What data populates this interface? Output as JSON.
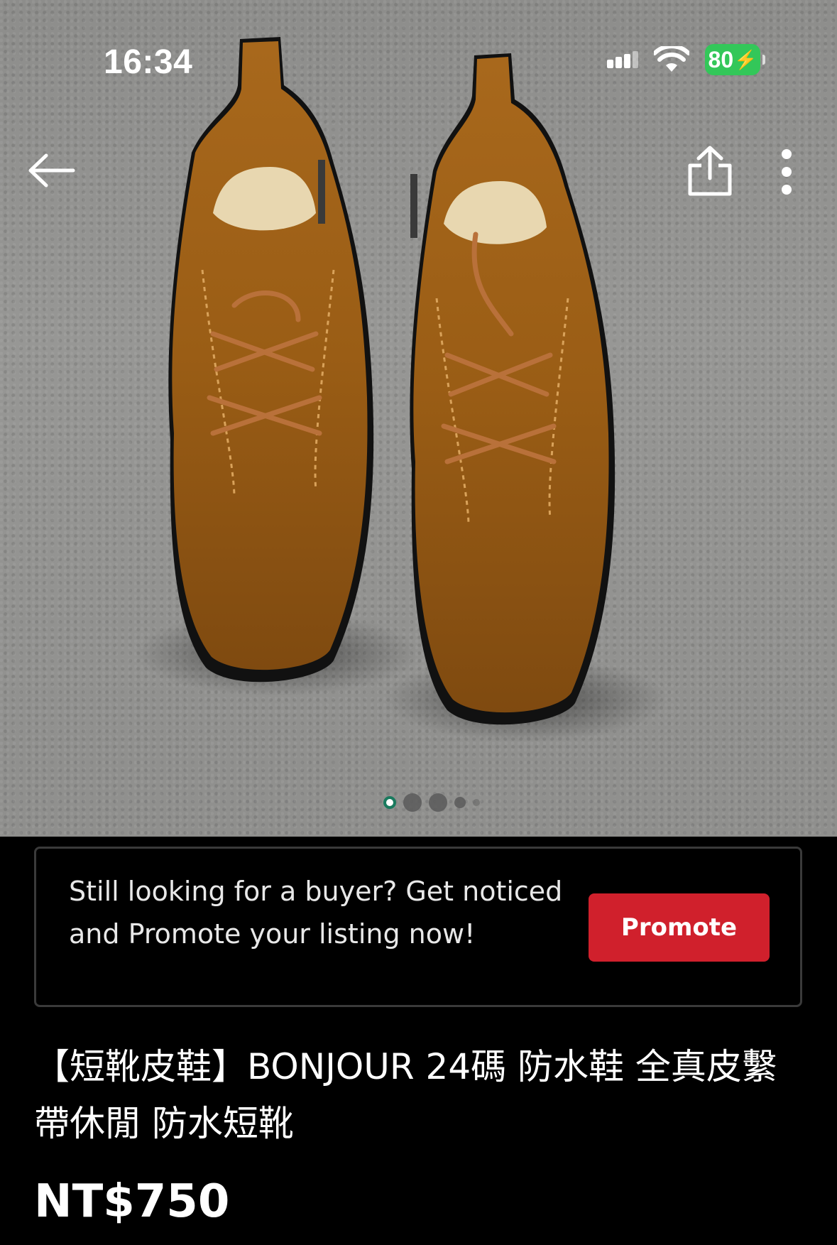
{
  "status_bar": {
    "time": "16:34",
    "battery": "80",
    "battery_charging": true,
    "battery_color": "#33c759"
  },
  "nav": {
    "back_icon": "arrow-left-icon",
    "share_icon": "share-icon",
    "more_icon": "more-vertical-icon"
  },
  "gallery": {
    "total_images": 5,
    "active_index": 0,
    "accent": "#1a7a5e"
  },
  "promo": {
    "text": "Still looking for a buyer? Get noticed and Promote your listing now!",
    "button_label": "Promote",
    "button_color": "#d0202c"
  },
  "listing": {
    "title": "【短靴皮鞋】BONJOUR 24碼 防水鞋 全真皮繫帶休閒 防水短靴",
    "price": "NT$750"
  }
}
